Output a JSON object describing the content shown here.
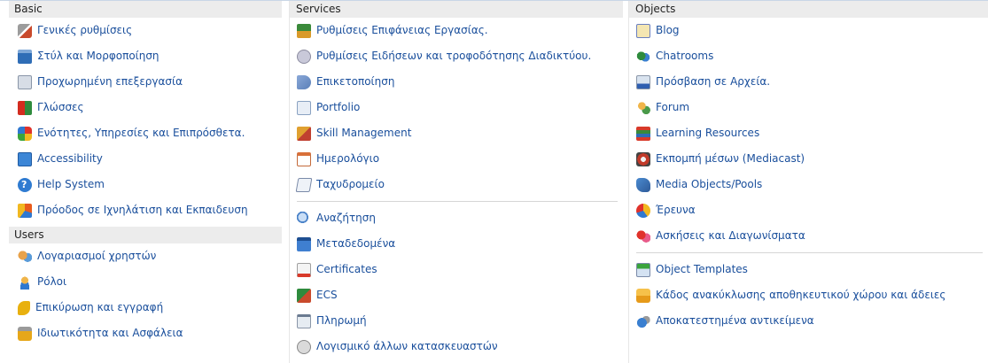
{
  "columns": {
    "basic": {
      "header": "Basic",
      "items": [
        {
          "label": "Γενικές ρυθμίσεις",
          "icon": "tools-icon"
        },
        {
          "label": "Στύλ και Μορφοποίηση",
          "icon": "style-icon"
        },
        {
          "label": "Προχωρημένη επεξεργασία",
          "icon": "advanced-editing-icon"
        },
        {
          "label": "Γλώσσες",
          "icon": "languages-icon"
        },
        {
          "label": "Ενότητες, Υπηρεσίες και Επιπρόσθετα.",
          "icon": "modules-icon"
        },
        {
          "label": "Accessibility",
          "icon": "accessibility-icon"
        },
        {
          "label": "Help System",
          "icon": "help-icon"
        },
        {
          "label": "Πρόοδος σε Ιχνηλάτιση και Εκπαιδευση",
          "icon": "tracking-icon"
        }
      ]
    },
    "users": {
      "header": "Users",
      "items": [
        {
          "label": "Λογαριασμοί χρηστών",
          "icon": "user-accounts-icon"
        },
        {
          "label": "Ρόλοι",
          "icon": "roles-icon"
        },
        {
          "label": "Επικύρωση και εγγραφή",
          "icon": "key-icon"
        },
        {
          "label": "Ιδιωτικότητα και Ασφάλεια",
          "icon": "lock-icon"
        }
      ]
    },
    "services": {
      "header": "Services",
      "group1": [
        {
          "label": "Ρυθμίσεις Επιφάνειας Εργασίας.",
          "icon": "desktop-icon"
        },
        {
          "label": "Ρυθμίσεις Ειδήσεων και τροφοδότησης Διαδικτύου.",
          "icon": "news-feed-icon"
        },
        {
          "label": "Επικετοποίηση",
          "icon": "tag-icon"
        },
        {
          "label": "Portfolio",
          "icon": "portfolio-icon"
        },
        {
          "label": "Skill Management",
          "icon": "skill-icon"
        },
        {
          "label": "Ημερολόγιο",
          "icon": "calendar-icon"
        },
        {
          "label": "Ταχυδρομείο",
          "icon": "mail-icon"
        }
      ],
      "group2": [
        {
          "label": "Αναζήτηση",
          "icon": "search-icon"
        },
        {
          "label": "Μεταδεδομένα",
          "icon": "metadata-icon"
        },
        {
          "label": "Certificates",
          "icon": "certificate-icon"
        },
        {
          "label": "ECS",
          "icon": "ecs-icon"
        },
        {
          "label": "Πληρωμή",
          "icon": "payment-icon"
        },
        {
          "label": "Λογισμικό άλλων κατασκευαστών",
          "icon": "third-party-software-icon"
        }
      ]
    },
    "objects": {
      "header": "Objects",
      "group1": [
        {
          "label": "Blog",
          "icon": "blog-icon"
        },
        {
          "label": "Chatrooms",
          "icon": "chat-icon"
        },
        {
          "label": "Πρόσβαση σε Αρχεία.",
          "icon": "file-access-icon"
        },
        {
          "label": "Forum",
          "icon": "forum-icon"
        },
        {
          "label": "Learning Resources",
          "icon": "learning-resources-icon"
        },
        {
          "label": "Εκπομπή μέσων (Mediacast)",
          "icon": "mediacast-icon"
        },
        {
          "label": "Media Objects/Pools",
          "icon": "media-pool-icon"
        },
        {
          "label": "Έρευνα",
          "icon": "survey-icon"
        },
        {
          "label": "Ασκήσεις και Διαγωνίσματα",
          "icon": "test-icon"
        }
      ],
      "group2": [
        {
          "label": "Object Templates",
          "icon": "object-templates-icon"
        },
        {
          "label": "Κάδος ανακύκλωσης αποθηκευτικού χώρου και άδειες",
          "icon": "recycle-bin-icon"
        },
        {
          "label": "Αποκατεστημένα αντικείμενα",
          "icon": "restored-objects-icon"
        }
      ]
    }
  }
}
